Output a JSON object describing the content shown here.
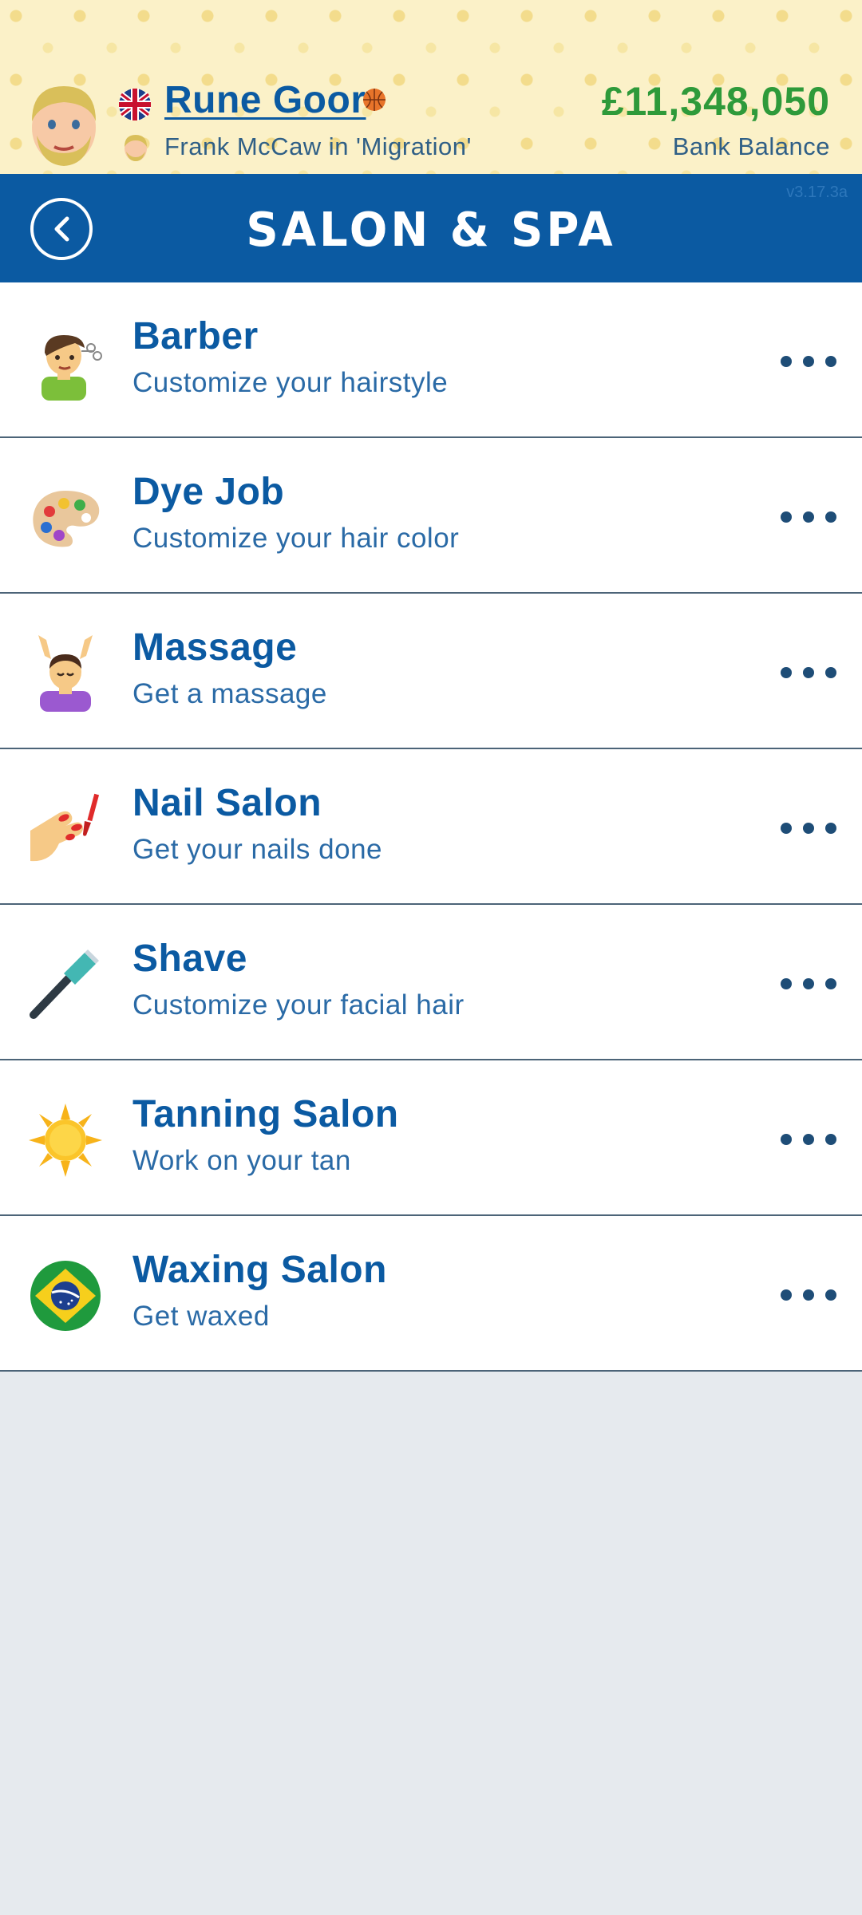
{
  "header": {
    "player_name": "Rune Goor",
    "subtitle": "Frank McCaw in 'Migration'",
    "balance": "£11,348,050",
    "balance_label": "Bank Balance"
  },
  "titlebar": {
    "title": "SALON & SPA",
    "version": "v3.17.3a"
  },
  "items": [
    {
      "title": "Barber",
      "desc": "Customize your hairstyle",
      "icon": "barber-icon"
    },
    {
      "title": "Dye Job",
      "desc": "Customize your hair color",
      "icon": "palette-icon"
    },
    {
      "title": "Massage",
      "desc": "Get a massage",
      "icon": "massage-icon"
    },
    {
      "title": "Nail Salon",
      "desc": "Get your nails done",
      "icon": "nail-polish-icon"
    },
    {
      "title": "Shave",
      "desc": "Customize your facial hair",
      "icon": "razor-icon"
    },
    {
      "title": "Tanning Salon",
      "desc": "Work on your tan",
      "icon": "sun-icon"
    },
    {
      "title": "Waxing Salon",
      "desc": "Get waxed",
      "icon": "brazil-flag-icon"
    }
  ],
  "colors": {
    "accent_blue": "#0b5aa2",
    "balance_green": "#2e9a3a",
    "background": "#e6eaee"
  }
}
